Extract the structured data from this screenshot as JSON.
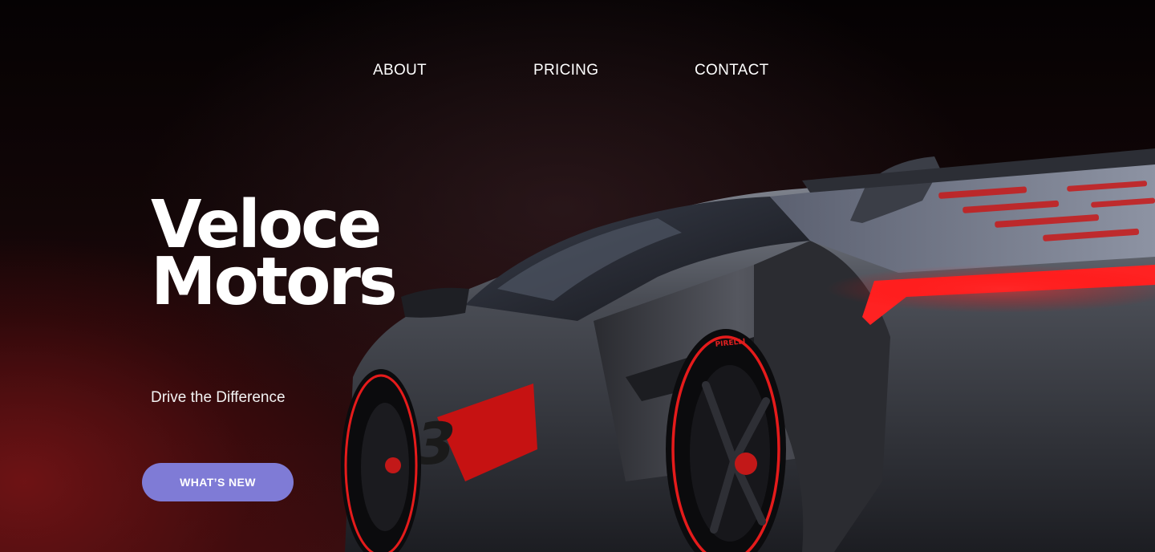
{
  "nav": {
    "items": [
      {
        "label": "ABOUT"
      },
      {
        "label": "PRICING"
      },
      {
        "label": "CONTACT"
      }
    ]
  },
  "hero": {
    "brand_line_1": "Veloce",
    "brand_line_2": "Motors",
    "tagline": "Drive the Difference",
    "cta_label": "WHAT’S NEW",
    "car_number": "63",
    "tire_brand": "PIRELLI"
  },
  "colors": {
    "cta_background": "#7f7bd6",
    "text": "#ffffff",
    "accent_red": "#e0191f",
    "background": "#050203"
  },
  "icons": {
    "car_image": "supercar-rear-three-quarter"
  }
}
